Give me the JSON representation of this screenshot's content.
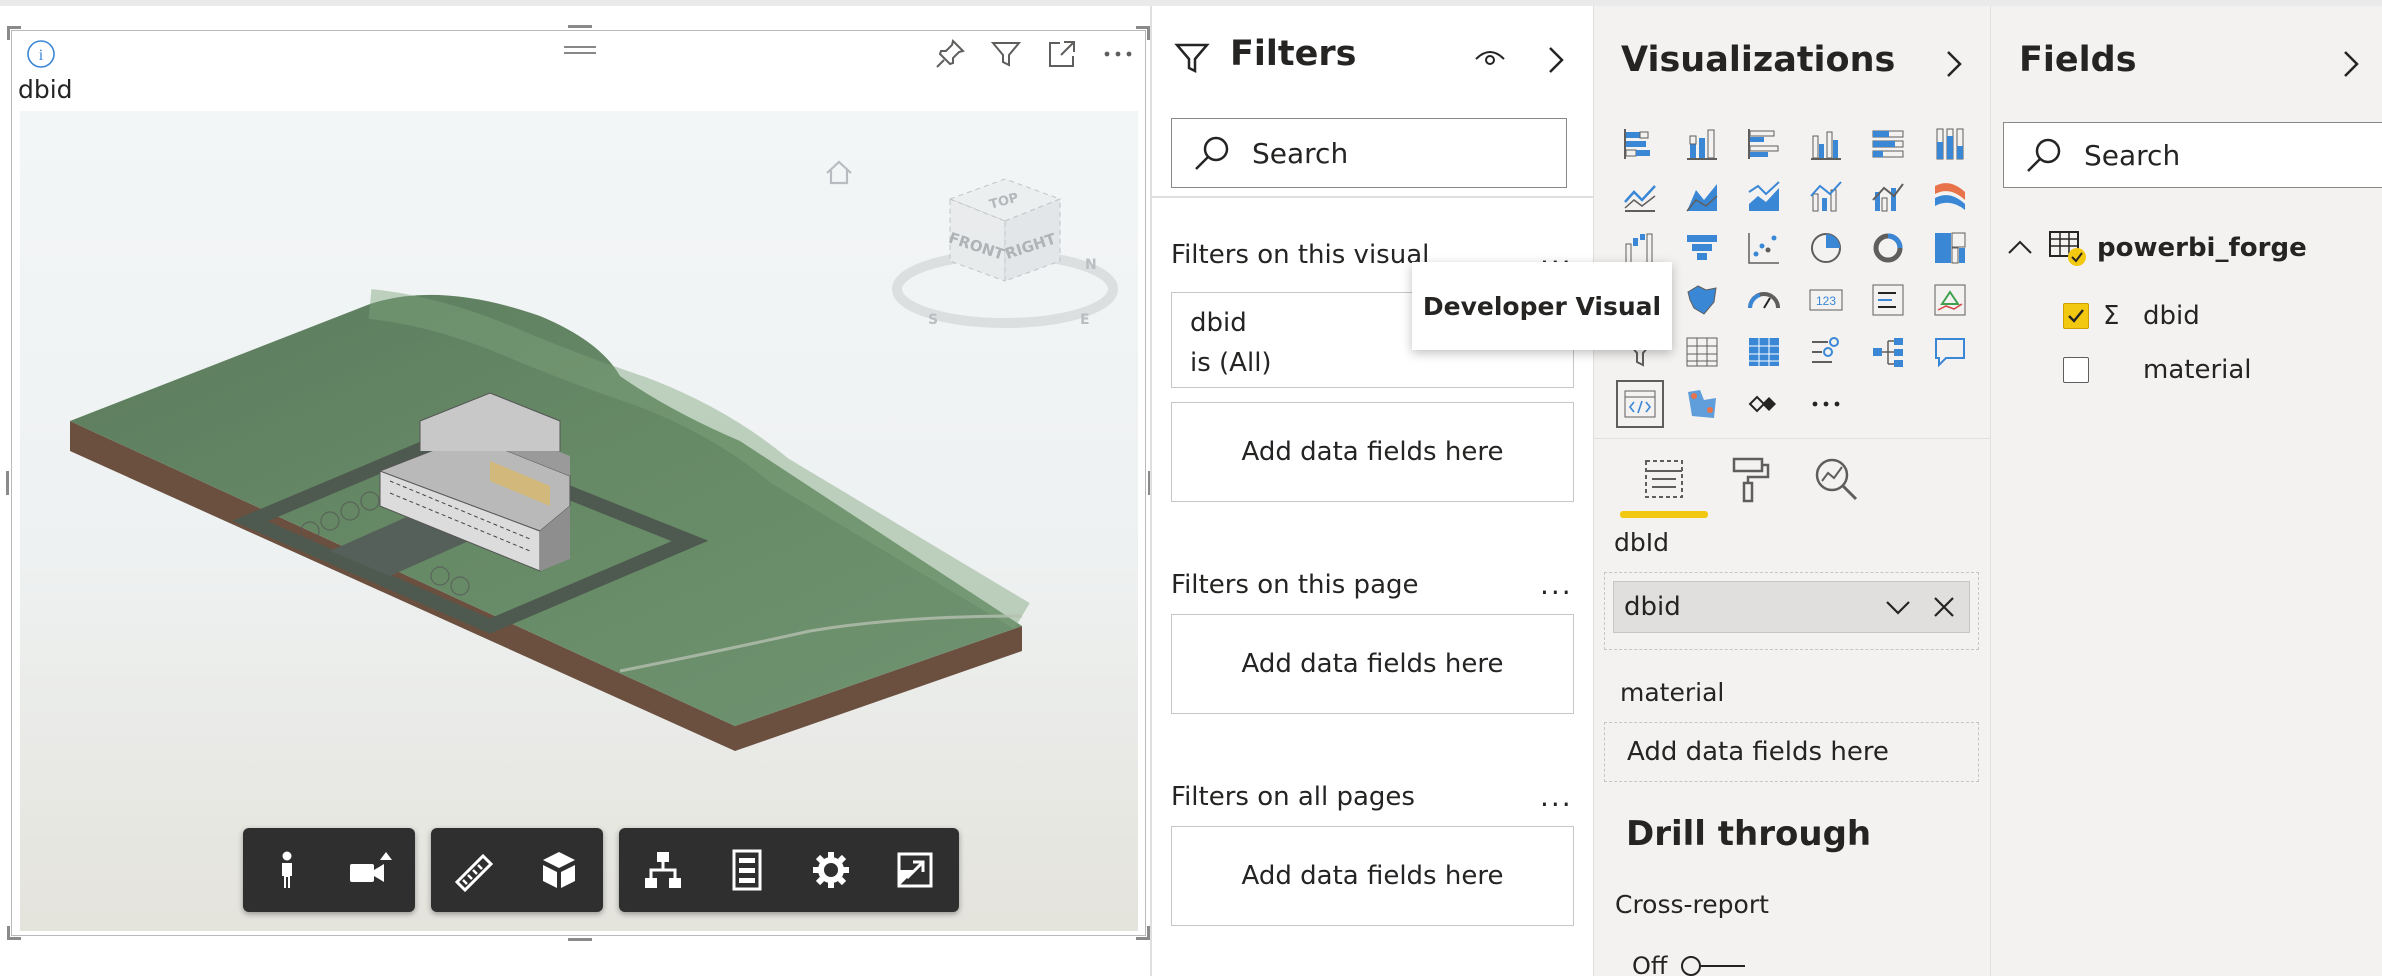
{
  "visual": {
    "title": "dbid",
    "header_icons": [
      "pin-icon",
      "filter-icon",
      "focus-mode-icon",
      "more-options-icon"
    ]
  },
  "viewer": {
    "viewcube": {
      "top": "TOP",
      "front": "FRONT",
      "right": "RIGHT",
      "compass": [
        "N",
        "E",
        "S"
      ]
    },
    "toolbar_groups": [
      [
        "walk-icon",
        "camera-icon"
      ],
      [
        "measure-icon",
        "section-icon"
      ],
      [
        "model-browser-icon",
        "properties-icon",
        "settings-icon",
        "fullscreen-icon"
      ]
    ]
  },
  "filters": {
    "title": "Filters",
    "search_placeholder": "Search",
    "on_visual_label": "Filters on this visual",
    "card_field": "dbid",
    "card_condition": "is (All)",
    "add_fields": "Add data fields here",
    "on_page_label": "Filters on this page",
    "on_all_pages_label": "Filters on all pages",
    "more": "..."
  },
  "tooltip": {
    "text": "Developer Visual"
  },
  "visualizations": {
    "title": "Visualizations",
    "more": "...",
    "well_dbid_label": "dbId",
    "well_dbid_pill": "dbid",
    "well_material_label": "material",
    "add_fields": "Add data fields here",
    "drill_title": "Drill through",
    "cross_report_label": "Cross-report",
    "toggle_label": "Off",
    "colors": {
      "blue": "#3a87d6",
      "gray": "#605e5c",
      "accent": "#f2c811"
    }
  },
  "fields": {
    "title": "Fields",
    "search_placeholder": "Search",
    "table_name": "powerbi_forge",
    "items": [
      {
        "name": "dbid",
        "checked": true,
        "sigma": "Σ"
      },
      {
        "name": "material",
        "checked": false,
        "sigma": ""
      }
    ]
  }
}
